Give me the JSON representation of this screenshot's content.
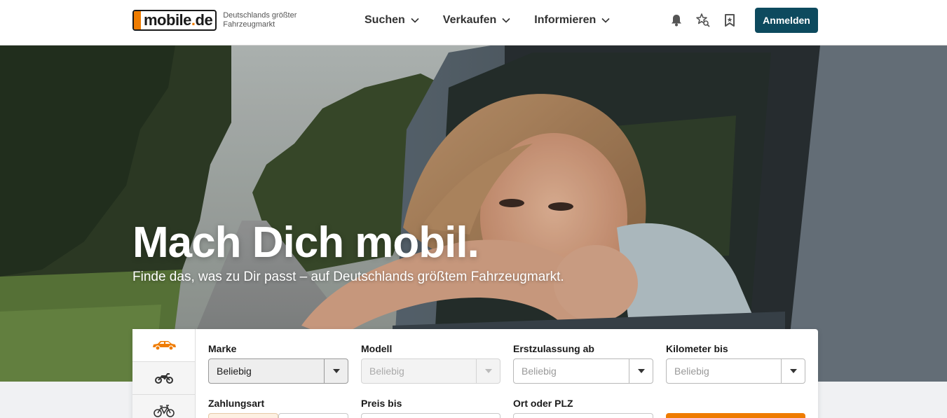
{
  "header": {
    "logo_text": "mobile",
    "logo_dot": ".",
    "logo_tld": "de",
    "tagline": "Deutschlands größter Fahrzeugmarkt",
    "nav": [
      {
        "label": "Suchen"
      },
      {
        "label": "Verkaufen"
      },
      {
        "label": "Informieren"
      }
    ],
    "icons": [
      "bell-icon",
      "star-search-icon",
      "bookmark-icon"
    ],
    "login_label": "Anmelden"
  },
  "hero": {
    "title": "Mach Dich mobil.",
    "subtitle": "Finde das, was zu Dir passt – auf Deutschlands größtem Fahrzeugmarkt."
  },
  "search": {
    "vehicle_tabs": [
      {
        "name": "car-icon",
        "active": true
      },
      {
        "name": "motorcycle-icon",
        "active": false
      },
      {
        "name": "bicycle-icon",
        "active": false
      }
    ],
    "fields": {
      "marke": {
        "label": "Marke",
        "value": "Beliebig"
      },
      "modell": {
        "label": "Modell",
        "value": "Beliebig"
      },
      "erstzulassung": {
        "label": "Erstzulassung ab",
        "value": "Beliebig"
      },
      "kilometer": {
        "label": "Kilometer bis",
        "value": "Beliebig"
      },
      "zahlungsart": {
        "label": "Zahlungsart"
      },
      "preis": {
        "label": "Preis bis"
      },
      "ort": {
        "label": "Ort oder PLZ"
      }
    }
  },
  "colors": {
    "brand_orange": "#ef7c00",
    "primary_teal": "#0d4a5e"
  }
}
